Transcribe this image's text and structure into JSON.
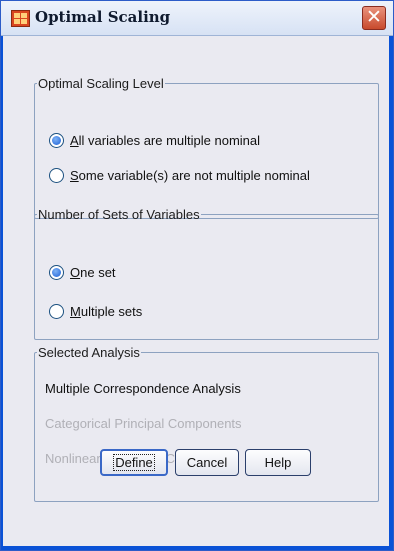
{
  "window": {
    "title": "Optimal Scaling",
    "close_label": "✕"
  },
  "level_group": {
    "legend": "Optimal Scaling Level",
    "options": [
      {
        "key": "A",
        "rest": "ll variables are multiple nominal",
        "checked": true
      },
      {
        "key": "S",
        "rest": "ome variable(s) are not multiple nominal",
        "checked": false
      }
    ]
  },
  "sets_group": {
    "legend": "Number of Sets of Variables",
    "options": [
      {
        "key": "O",
        "rest": "ne set",
        "checked": true
      },
      {
        "key": "M",
        "rest": "ultiple sets",
        "checked": false
      }
    ]
  },
  "analysis_group": {
    "legend": "Selected Analysis",
    "items": [
      {
        "label": "Multiple Correspondence Analysis",
        "enabled": true
      },
      {
        "label": "Categorical Principal Components",
        "enabled": false
      },
      {
        "label": "Nonlinear Canonical Correlation",
        "enabled": false
      }
    ]
  },
  "buttons": {
    "define": "Define",
    "cancel": "Cancel",
    "help": "Help"
  }
}
